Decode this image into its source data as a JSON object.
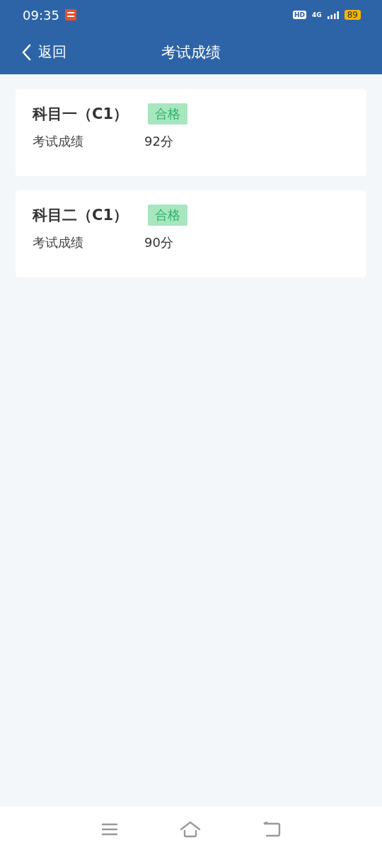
{
  "status_bar": {
    "time": "09:35",
    "hd": "HD",
    "network": "4G",
    "battery": "89"
  },
  "nav": {
    "back": "返回",
    "title": "考试成绩"
  },
  "results": [
    {
      "subject": "科目一（C1）",
      "tag": "合格",
      "label": "考试成绩",
      "score": "92分"
    },
    {
      "subject": "科目二（C1）",
      "tag": "合格",
      "label": "考试成绩",
      "score": "90分"
    }
  ]
}
